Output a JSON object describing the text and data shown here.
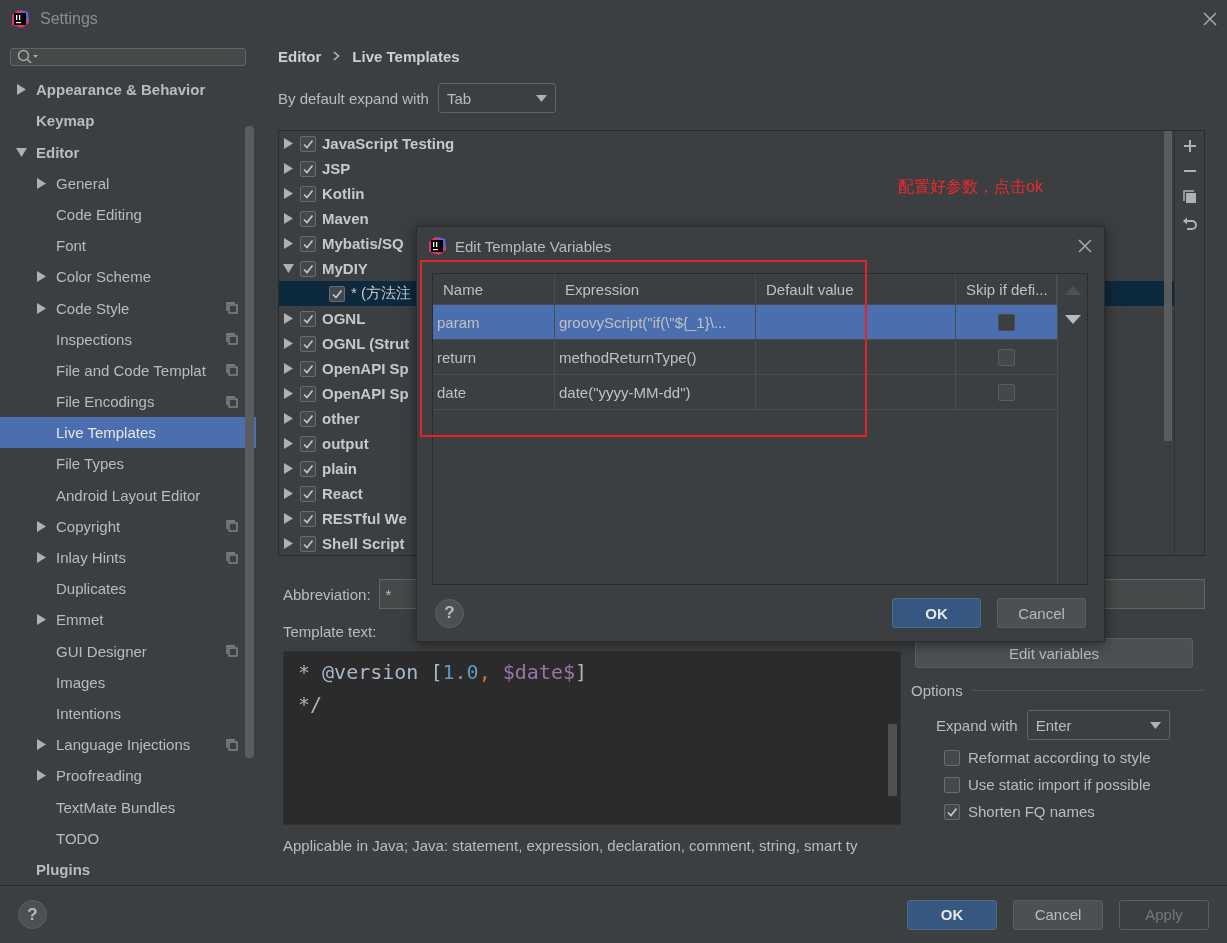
{
  "window": {
    "title": "Settings"
  },
  "sidebar": {
    "items": [
      {
        "label": "Appearance & Behavior",
        "expanded": false,
        "selected": false
      },
      {
        "label": "Keymap",
        "selected": false
      },
      {
        "label": "Editor",
        "expanded": true,
        "selected": false,
        "children": [
          {
            "label": "General",
            "expanded": false,
            "selected": false
          },
          {
            "label": "Code Editing",
            "selected": false
          },
          {
            "label": "Font",
            "selected": false
          },
          {
            "label": "Color Scheme",
            "expanded": false,
            "selected": false
          },
          {
            "label": "Code Style",
            "expanded": false,
            "selected": false,
            "project_level": true
          },
          {
            "label": "Inspections",
            "selected": false,
            "project_level": true
          },
          {
            "label": "File and Code Templat",
            "selected": false,
            "project_level": true
          },
          {
            "label": "File Encodings",
            "selected": false,
            "project_level": true
          },
          {
            "label": "Live Templates",
            "selected": true
          },
          {
            "label": "File Types",
            "selected": false
          },
          {
            "label": "Android Layout Editor",
            "selected": false
          },
          {
            "label": "Copyright",
            "expanded": false,
            "selected": false,
            "project_level": true
          },
          {
            "label": "Inlay Hints",
            "expanded": false,
            "selected": false,
            "project_level": true
          },
          {
            "label": "Duplicates",
            "selected": false
          },
          {
            "label": "Emmet",
            "expanded": false,
            "selected": false
          },
          {
            "label": "GUI Designer",
            "selected": false,
            "project_level": true
          },
          {
            "label": "Images",
            "selected": false
          },
          {
            "label": "Intentions",
            "selected": false
          },
          {
            "label": "Language Injections",
            "expanded": false,
            "selected": false,
            "project_level": true
          },
          {
            "label": "Proofreading",
            "expanded": false,
            "selected": false
          },
          {
            "label": "TextMate Bundles",
            "selected": false
          },
          {
            "label": "TODO",
            "selected": false
          }
        ]
      },
      {
        "label": "Plugins",
        "selected": false
      }
    ]
  },
  "breadcrumb": [
    "Editor",
    "Live Templates"
  ],
  "expand_default": {
    "label": "By default expand with",
    "value": "Tab"
  },
  "template_groups": [
    {
      "label": "JavaScript Testing",
      "checked": true,
      "expanded": false,
      "selected": false
    },
    {
      "label": "JSP",
      "checked": true,
      "expanded": false,
      "selected": false
    },
    {
      "label": "Kotlin",
      "checked": true,
      "expanded": false,
      "selected": false
    },
    {
      "label": "Maven",
      "checked": true,
      "expanded": false,
      "selected": false
    },
    {
      "label": "Mybatis/SQ",
      "checked": true,
      "expanded": false,
      "selected": false
    },
    {
      "label": "MyDIY",
      "checked": true,
      "expanded": true,
      "selected": false,
      "children": [
        {
          "label": "* (方法注",
          "checked": true,
          "selected": true
        }
      ]
    },
    {
      "label": "OGNL",
      "checked": true,
      "expanded": false,
      "selected": false
    },
    {
      "label": "OGNL (Strut",
      "checked": true,
      "expanded": false,
      "selected": false
    },
    {
      "label": "OpenAPI Sp",
      "checked": true,
      "expanded": false,
      "selected": false
    },
    {
      "label": "OpenAPI Sp",
      "checked": true,
      "expanded": false,
      "selected": false
    },
    {
      "label": "other",
      "checked": true,
      "expanded": false,
      "selected": false
    },
    {
      "label": "output",
      "checked": true,
      "expanded": false,
      "selected": false
    },
    {
      "label": "plain",
      "checked": true,
      "expanded": false,
      "selected": false
    },
    {
      "label": "React",
      "checked": true,
      "expanded": false,
      "selected": false
    },
    {
      "label": "RESTful We",
      "checked": true,
      "expanded": false,
      "selected": false
    },
    {
      "label": "Shell Script",
      "checked": true,
      "expanded": false,
      "selected": false
    }
  ],
  "abbreviation": {
    "label": "Abbreviation:",
    "value": "*"
  },
  "template_text": {
    "label": "Template text:",
    "lines": [
      [
        {
          "text": "* @version [",
          "kind": "plain"
        },
        {
          "text": "1.0",
          "kind": "number"
        },
        {
          "text": ", ",
          "kind": "punct"
        },
        {
          "text": "$date$",
          "kind": "variable"
        },
        {
          "text": "]",
          "kind": "plain"
        }
      ],
      [
        {
          "text": "*/",
          "kind": "plain"
        }
      ]
    ]
  },
  "applicable": "Applicable in Java; Java: statement, expression, declaration, comment, string, smart ty",
  "edit_variables_button": "Edit variables",
  "options": {
    "title": "Options",
    "expand_with": {
      "label": "Expand with",
      "value": "Enter"
    },
    "checkboxes": [
      {
        "label": "Reformat according to style",
        "checked": false
      },
      {
        "label": "Use static import if possible",
        "checked": false
      },
      {
        "label": "Shorten FQ names",
        "checked": true
      }
    ]
  },
  "dialog": {
    "title": "Edit Template Variables",
    "columns": [
      "Name",
      "Expression",
      "Default value",
      "Skip if defi..."
    ],
    "rows": [
      {
        "name": "param",
        "expression": "groovyScript(\"if(\\\"${_1}\\...",
        "skip": false,
        "selected": true
      },
      {
        "name": "return",
        "expression": "methodReturnType()",
        "skip": false,
        "selected": false
      },
      {
        "name": "date",
        "expression": "date(\"yyyy-MM-dd\")",
        "skip": false,
        "selected": false
      }
    ],
    "help_button": "?",
    "buttons": [
      {
        "label": "OK",
        "kind": "primary"
      },
      {
        "label": "Cancel",
        "kind": "normal"
      }
    ]
  },
  "annotation": "配置好参数，点击ok",
  "help_button": "?",
  "buttons": [
    {
      "label": "OK",
      "kind": "primary"
    },
    {
      "label": "Cancel",
      "kind": "normal"
    },
    {
      "label": "Apply",
      "kind": "disabled"
    }
  ]
}
